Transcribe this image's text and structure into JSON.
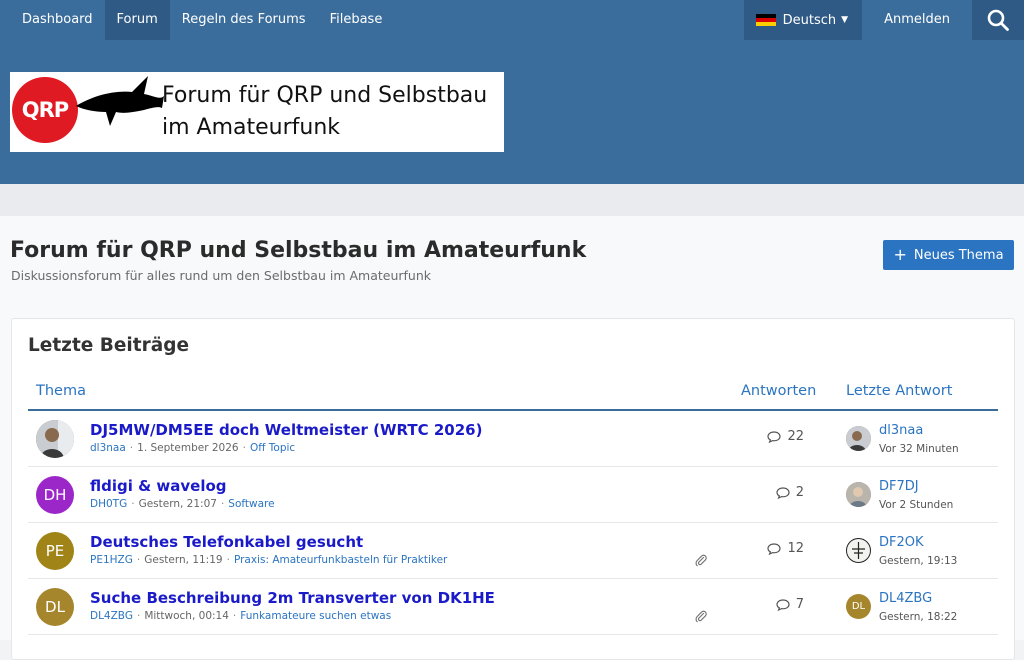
{
  "nav": {
    "items": [
      {
        "label": "Dashboard",
        "active": false
      },
      {
        "label": "Forum",
        "active": true
      },
      {
        "label": "Regeln des Forums",
        "active": false
      },
      {
        "label": "Filebase",
        "active": false
      }
    ],
    "language": "Deutsch",
    "login": "Anmelden"
  },
  "logo": {
    "badge": "QRP",
    "line1": "Forum für QRP und Selbstbau",
    "line2": "im Amateurfunk"
  },
  "page": {
    "title": "Forum für QRP und Selbstbau im Amateurfunk",
    "subtitle": "Diskussionsforum für alles rund um den Selbstbau im Amateurfunk",
    "new_topic": "Neues Thema"
  },
  "recent": {
    "title": "Letzte Beiträge",
    "columns": {
      "topic": "Thema",
      "replies": "Antworten",
      "last": "Letzte Antwort"
    },
    "rows": [
      {
        "title": "DJ5MW/DM5EE doch Weltmeister (WRTC 2026)",
        "author": "dl3naa",
        "date": "1. September 2026",
        "category": "Off Topic",
        "replies": "22",
        "last_user": "dl3naa",
        "last_time": "Vor 32 Minuten",
        "avatar_initials": "",
        "avatar_color": "#7a6a58",
        "attachment": false
      },
      {
        "title": "fldigi & wavelog",
        "author": "DH0TG",
        "date": "Gestern, 21:07",
        "category": "Software",
        "replies": "2",
        "last_user": "DF7DJ",
        "last_time": "Vor 2 Stunden",
        "avatar_initials": "DH",
        "avatar_color": "#9b27c9",
        "attachment": false
      },
      {
        "title": "Deutsches Telefonkabel gesucht",
        "author": "PE1HZG",
        "date": "Gestern, 11:19",
        "category": "Praxis: Amateurfunkbasteln für Praktiker",
        "replies": "12",
        "last_user": "DF2OK",
        "last_time": "Gestern, 19:13",
        "avatar_initials": "PE",
        "avatar_color": "#a08418",
        "attachment": true
      },
      {
        "title": "Suche Beschreibung 2m Transverter von DK1HE",
        "author": "DL4ZBG",
        "date": "Mittwoch, 00:14",
        "category": "Funkamateure suchen etwas",
        "replies": "7",
        "last_user": "DL4ZBG",
        "last_time": "Gestern, 18:22",
        "avatar_initials": "DL",
        "avatar_color": "#a6862c",
        "attachment": true
      }
    ],
    "last_avatars": [
      {
        "initials": "",
        "color": "#7a6a58"
      },
      {
        "initials": "",
        "color": "#9a8d7e"
      },
      {
        "initials": "",
        "color": "#f2f2ee"
      },
      {
        "initials": "DL",
        "color": "#a6862c"
      }
    ]
  },
  "colors": {
    "nav": "#3a6d9c",
    "nav_active": "#2e5a85",
    "accent": "#2b74c1",
    "topic_link": "#1a1ac8",
    "qrp_red": "#e01a22"
  }
}
